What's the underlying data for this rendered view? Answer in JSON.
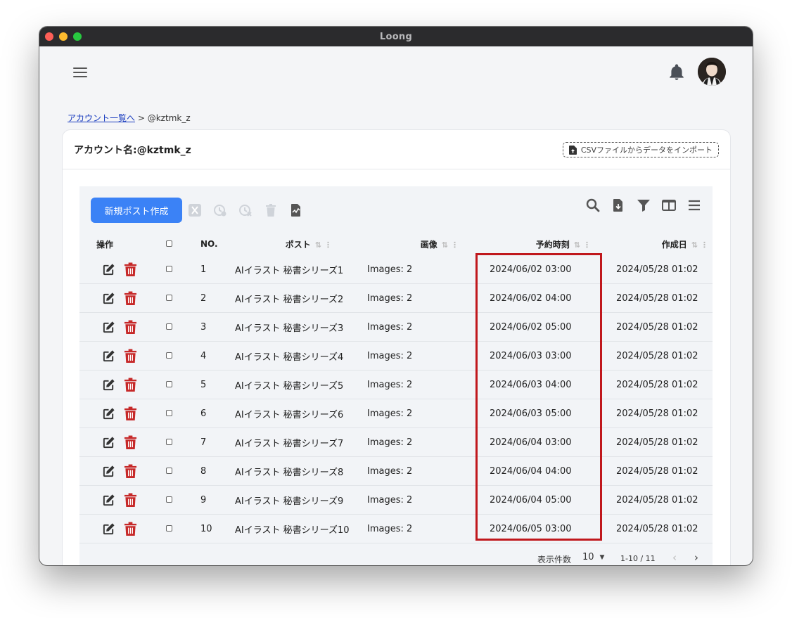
{
  "window": {
    "title": "Loong"
  },
  "header": {
    "menu_icon": "hamburger-icon",
    "notification_icon": "bell-icon"
  },
  "breadcrumb": {
    "link_label": "アカウント一覧へ",
    "separator": ">",
    "current": "@kztmk_z"
  },
  "card": {
    "title": "アカウント名:@kztmk_z",
    "csv_import_label": "CSVファイルからデータをインポート"
  },
  "toolbar": {
    "new_post_label": "新規ポスト作成",
    "icons_left": [
      "x-logo-icon",
      "clock-check-icon",
      "clock-x-icon",
      "trash-icon",
      "file-chart-icon"
    ],
    "icons_right": [
      "search-icon",
      "file-download-icon",
      "filter-icon",
      "columns-icon",
      "menu-lines-icon"
    ]
  },
  "table": {
    "headers": {
      "ops": "操作",
      "no": "NO.",
      "post": "ポスト",
      "image": "画像",
      "scheduled": "予約時刻",
      "created": "作成日"
    },
    "rows": [
      {
        "no": "1",
        "post": "AIイラスト 秘書シリーズ1",
        "image": "Images: 2",
        "scheduled": "2024/06/02 03:00",
        "created": "2024/05/28 01:02"
      },
      {
        "no": "2",
        "post": "AIイラスト 秘書シリーズ2",
        "image": "Images: 2",
        "scheduled": "2024/06/02 04:00",
        "created": "2024/05/28 01:02"
      },
      {
        "no": "3",
        "post": "AIイラスト 秘書シリーズ3",
        "image": "Images: 2",
        "scheduled": "2024/06/02 05:00",
        "created": "2024/05/28 01:02"
      },
      {
        "no": "4",
        "post": "AIイラスト 秘書シリーズ4",
        "image": "Images: 2",
        "scheduled": "2024/06/03 03:00",
        "created": "2024/05/28 01:02"
      },
      {
        "no": "5",
        "post": "AIイラスト 秘書シリーズ5",
        "image": "Images: 2",
        "scheduled": "2024/06/03 04:00",
        "created": "2024/05/28 01:02"
      },
      {
        "no": "6",
        "post": "AIイラスト 秘書シリーズ6",
        "image": "Images: 2",
        "scheduled": "2024/06/03 05:00",
        "created": "2024/05/28 01:02"
      },
      {
        "no": "7",
        "post": "AIイラスト 秘書シリーズ7",
        "image": "Images: 2",
        "scheduled": "2024/06/04 03:00",
        "created": "2024/05/28 01:02"
      },
      {
        "no": "8",
        "post": "AIイラスト 秘書シリーズ8",
        "image": "Images: 2",
        "scheduled": "2024/06/04 04:00",
        "created": "2024/05/28 01:02"
      },
      {
        "no": "9",
        "post": "AIイラスト 秘書シリーズ9",
        "image": "Images: 2",
        "scheduled": "2024/06/04 05:00",
        "created": "2024/05/28 01:02"
      },
      {
        "no": "10",
        "post": "AIイラスト 秘書シリーズ10",
        "image": "Images: 2",
        "scheduled": "2024/06/05 03:00",
        "created": "2024/05/28 01:02"
      }
    ]
  },
  "pagination": {
    "rows_per_page_label": "表示件数",
    "rows_per_page_value": "10",
    "range": "1-10 / 11",
    "prev": "‹",
    "next": "›"
  },
  "colors": {
    "accent": "#3b82f6",
    "danger": "#c62828",
    "highlight": "#c0171c"
  }
}
